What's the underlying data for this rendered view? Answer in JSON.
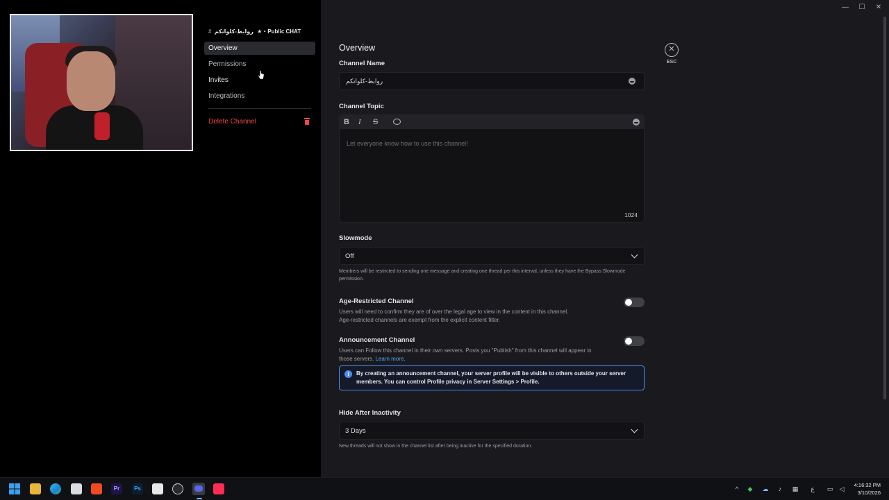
{
  "nav": {
    "header_hash": "#",
    "header_channel": "روابط-كلواتكم",
    "header_server": "★・Public CHAT",
    "items": [
      {
        "label": "Overview"
      },
      {
        "label": "Permissions"
      },
      {
        "label": "Invites"
      },
      {
        "label": "Integrations"
      }
    ],
    "delete_label": "Delete Channel"
  },
  "main": {
    "title": "Overview",
    "channel_name_label": "Channel Name",
    "channel_name_value": "روابط-كلواتكم",
    "channel_topic_label": "Channel Topic",
    "topic_placeholder": "Let everyone know how to use this channel!",
    "topic_counter": "1024",
    "toolbar": {
      "bold": "B",
      "italic": "I",
      "strike": "S"
    },
    "slowmode_label": "Slowmode",
    "slowmode_value": "Off",
    "slowmode_help": "Members will be restricted to sending one message and creating one thread per this interval, unless they have the Bypass Slowmode permission.",
    "age_label": "Age-Restricted Channel",
    "age_desc_1": "Users will need to confirm they are of over the legal age to view in the content in this channel.",
    "age_desc_2": "Age-restricted channels are exempt from the explicit content filter.",
    "announce_label": "Announcement Channel",
    "announce_desc": "Users can Follow this channel in their own servers. Posts you \"Publish\" from this channel will appear in those servers.",
    "announce_link": "Learn more.",
    "info_text": "By creating an announcement channel, your server profile will be visible to others outside your server members. You can control Profile privacy in Server Settings > Profile.",
    "hide_label": "Hide After Inactivity",
    "hide_value": "3 Days",
    "hide_help": "New threads will not show in the channel list after being inactive for the specified duration.",
    "toggles": {
      "age_restricted": false,
      "announcement": false
    }
  },
  "esc": {
    "label": "ESC",
    "close_glyph": "✕"
  },
  "window_controls": {
    "minimize": "—",
    "maximize": "☐",
    "close": "✕"
  },
  "taskbar": {
    "apps": [
      "windows-start",
      "file-explorer",
      "edge",
      "store",
      "brave",
      "premiere-pro",
      "photoshop",
      "capcut",
      "obs",
      "discord",
      "tiktok"
    ],
    "language": "ع",
    "time": "4:16:32 PM",
    "date": "3/10/2026"
  },
  "colors": {
    "accent": "#4e8cf3",
    "danger": "#f0474b",
    "bg_main": "#1a1a1e"
  }
}
